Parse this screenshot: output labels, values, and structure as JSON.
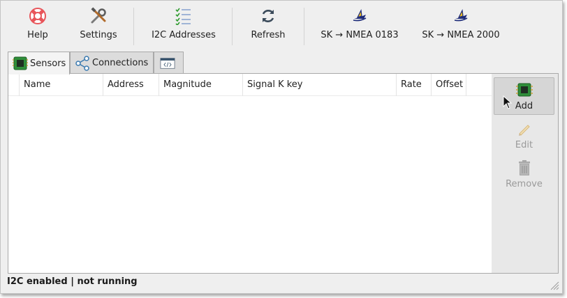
{
  "toolbar": {
    "help": "Help",
    "settings": "Settings",
    "i2c": "I2C Addresses",
    "refresh": "Refresh",
    "nmea0183": "SK → NMEA 0183",
    "nmea2000": "SK → NMEA 2000"
  },
  "tabs": {
    "sensors": "Sensors",
    "connections": "Connections"
  },
  "table": {
    "columns": [
      "Name",
      "Address",
      "Magnitude",
      "Signal K key",
      "Rate",
      "Offset"
    ]
  },
  "actions": {
    "add": "Add",
    "edit": "Edit",
    "remove": "Remove"
  },
  "status": "I2C enabled | not running",
  "colors": {
    "window_bg": "#efefef",
    "help_icon": "#e8555a",
    "check_green": "#2e9a2e",
    "chip_green": "#2f8f3a",
    "boat_navy": "#1c2a78",
    "boat_yellow": "#f0c020"
  }
}
